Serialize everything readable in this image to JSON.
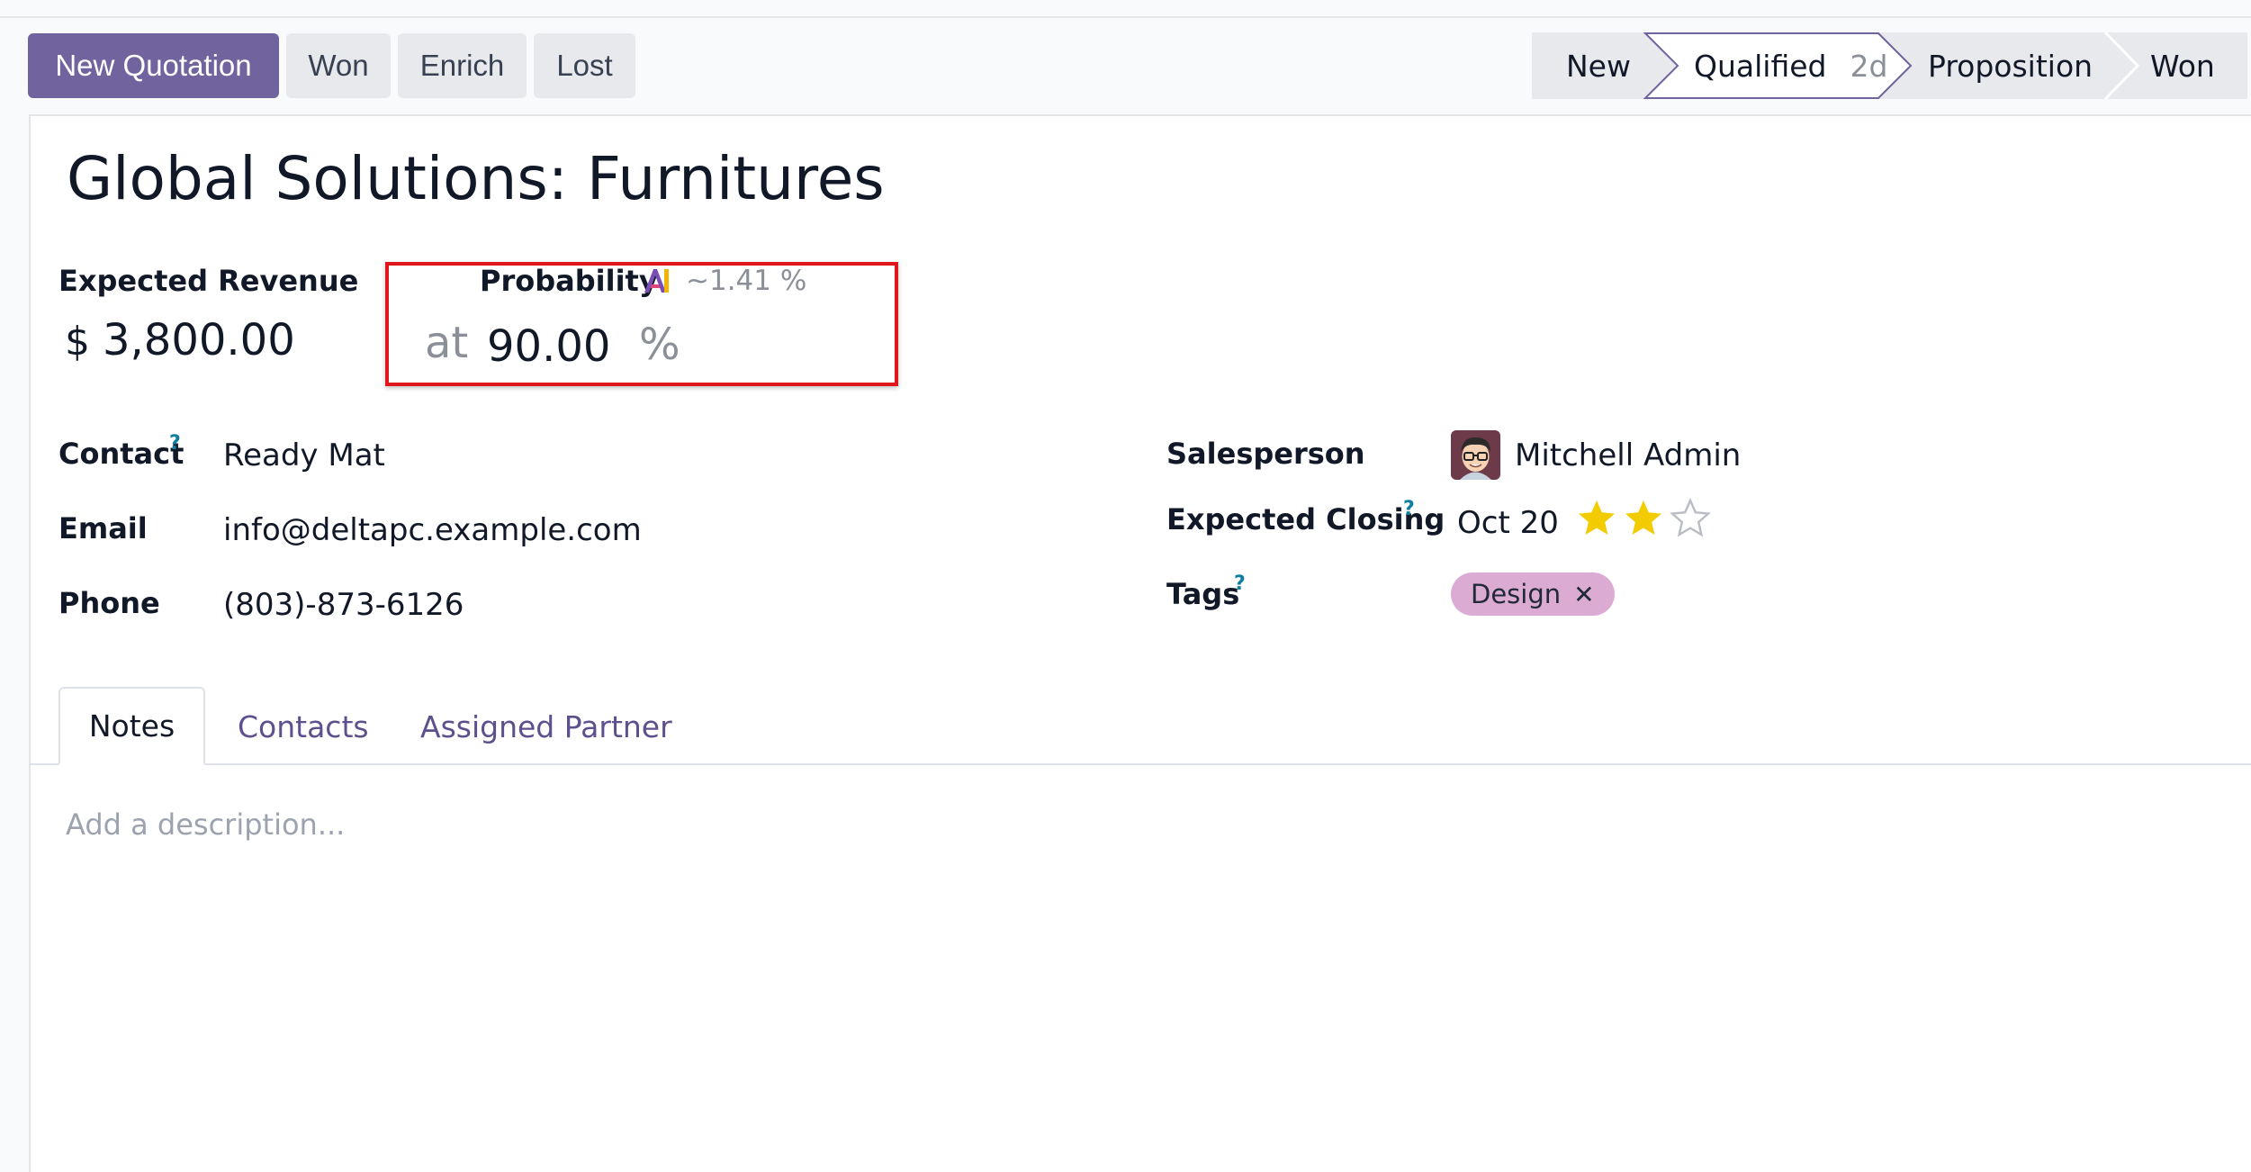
{
  "control_panel": {
    "new_quotation": "New Quotation",
    "won": "Won",
    "enrich": "Enrich",
    "lost": "Lost"
  },
  "pipeline": {
    "stages": [
      {
        "label": "New",
        "badge": ""
      },
      {
        "label": "Qualified",
        "badge": "2d"
      },
      {
        "label": "Proposition",
        "badge": ""
      },
      {
        "label": "Won",
        "badge": ""
      }
    ],
    "active_stage": "Qualified",
    "active_color": "#71639e"
  },
  "record": {
    "title": "Global Solutions: Furnitures",
    "expected_revenue": {
      "label": "Expected Revenue",
      "currency": "$",
      "amount": "3,800.00"
    },
    "probability": {
      "label": "Probability",
      "ai_prediction": "~1.41 %",
      "at": "at",
      "value": "90.00",
      "unit": "%"
    },
    "contact": {
      "label": "Contact",
      "help": "?",
      "value": "Ready Mat"
    },
    "email": {
      "label": "Email",
      "value": "info@deltapc.example.com"
    },
    "phone": {
      "label": "Phone",
      "value": "(803)-873-6126"
    },
    "salesperson": {
      "label": "Salesperson",
      "value": "Mitchell Admin"
    },
    "expected_closing": {
      "label": "Expected Closing",
      "help": "?",
      "value": "Oct 20"
    },
    "priority": {
      "filled": 2,
      "max": 3,
      "filled_color": "#f3cc00"
    },
    "tags": {
      "label": "Tags",
      "help": "?",
      "items": [
        "Design"
      ]
    }
  },
  "tabs": [
    {
      "label": "Notes",
      "active": true
    },
    {
      "label": "Contacts",
      "active": false
    },
    {
      "label": "Assigned Partner",
      "active": false
    }
  ],
  "notes": {
    "placeholder": "Add a description..."
  },
  "colors": {
    "primary": "#71639e",
    "highlight_box": "#e0161d",
    "tag_bg": "#dcabd4"
  }
}
